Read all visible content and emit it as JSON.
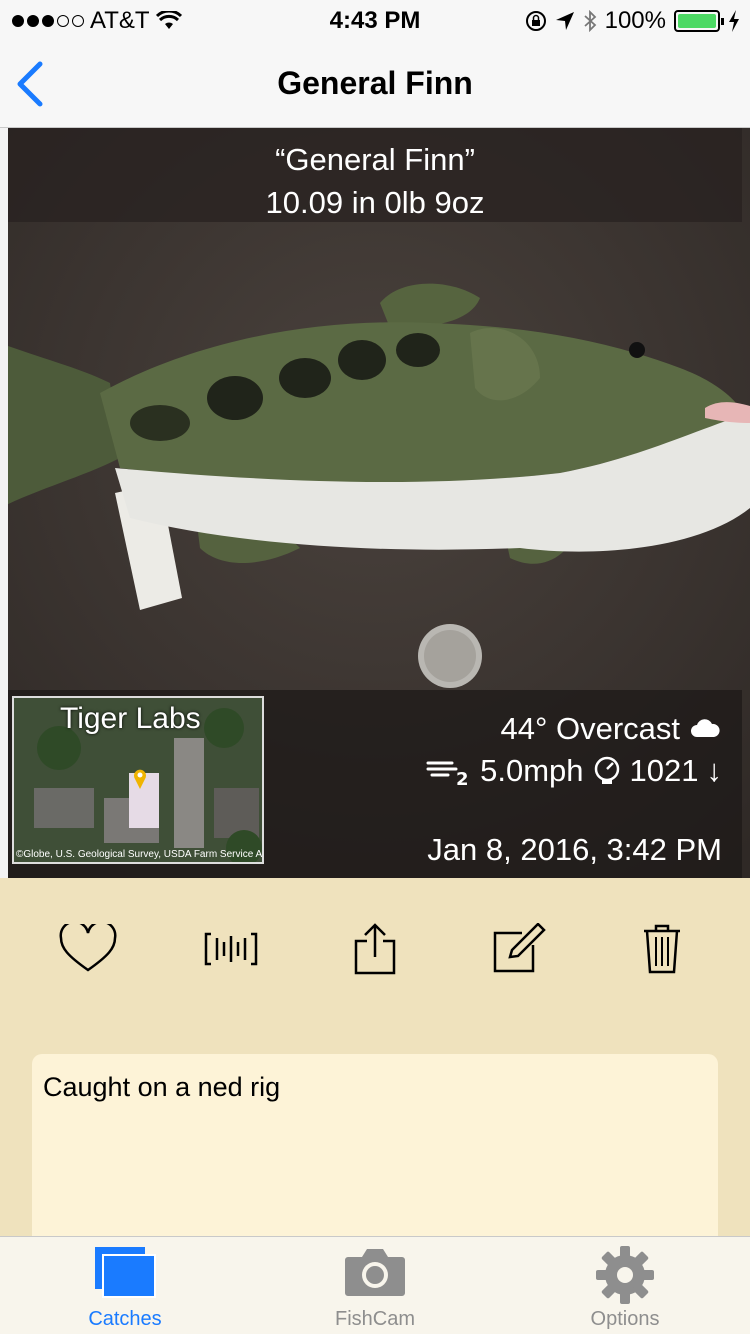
{
  "status_bar": {
    "carrier": "AT&T",
    "time": "4:43 PM",
    "battery": "100%",
    "battery_fraction": 1.0
  },
  "nav": {
    "title": "General Finn",
    "back_icon": "chevron-left-icon"
  },
  "photo": {
    "name_caption": "“General Finn”",
    "size_caption": "10.09 in 0lb 9oz",
    "map": {
      "label": "Tiger Labs",
      "attribution": "©Globe, U.S. Geological Survey, USDA Farm Service Agency"
    },
    "weather": {
      "conditions": "44° Overcast",
      "wind": "5.0mph",
      "pressure": "1021",
      "pressure_trend": "↓"
    },
    "date": "Jan 8, 2016, 3:42 PM"
  },
  "actions": [
    {
      "name": "favorite",
      "icon": "heart-icon"
    },
    {
      "name": "measure",
      "icon": "ruler-icon"
    },
    {
      "name": "share",
      "icon": "share-icon"
    },
    {
      "name": "edit",
      "icon": "edit-icon"
    },
    {
      "name": "delete",
      "icon": "trash-icon"
    }
  ],
  "notes": {
    "text": "Caught on a ned rig"
  },
  "tabs": [
    {
      "label": "Catches",
      "icon": "catches-icon",
      "active": true
    },
    {
      "label": "FishCam",
      "icon": "camera-icon",
      "active": false
    },
    {
      "label": "Options",
      "icon": "gear-icon",
      "active": false
    }
  ],
  "colors": {
    "accent": "#1a7bff",
    "background": "#efe2bd",
    "notes_background": "#fdf3d7",
    "battery_green": "#4cd964"
  }
}
